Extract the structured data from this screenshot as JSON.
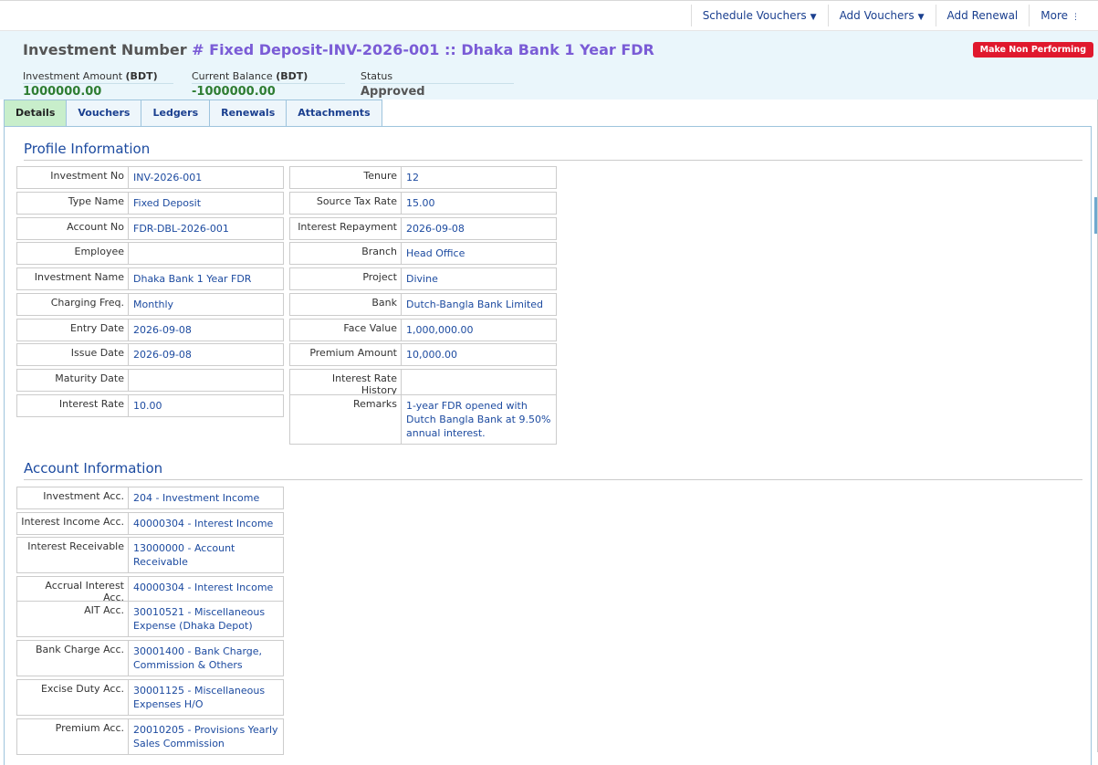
{
  "toolbar": {
    "schedule_vouchers": "Schedule Vouchers",
    "add_vouchers": "Add Vouchers",
    "add_renewal": "Add Renewal",
    "more": "More"
  },
  "header": {
    "title_prefix": "Investment Number",
    "title_highlight": "# Fixed Deposit-INV-2026-001 :: Dhaka Bank 1 Year FDR",
    "action_button": "Make Non Performing",
    "summary": {
      "investment_amount": {
        "label": "Investment Amount",
        "unit": "(BDT)",
        "value": "1000000.00"
      },
      "current_balance": {
        "label": "Current Balance",
        "unit": "(BDT)",
        "value": "-1000000.00"
      },
      "status": {
        "label": "Status",
        "value": "Approved"
      }
    }
  },
  "tabs": [
    "Details",
    "Vouchers",
    "Ledgers",
    "Renewals",
    "Attachments"
  ],
  "profile": {
    "title": "Profile Information",
    "left": [
      {
        "label": "Investment No",
        "value": "INV-2026-001"
      },
      {
        "label": "Type Name",
        "value": "Fixed Deposit"
      },
      {
        "label": "Account No",
        "value": "FDR-DBL-2026-001"
      },
      {
        "label": "Employee",
        "value": ""
      },
      {
        "label": "Investment Name",
        "value": "Dhaka Bank 1 Year FDR"
      },
      {
        "label": "Charging Freq.",
        "value": "Monthly"
      },
      {
        "label": "Entry Date",
        "value": "2026-09-08"
      },
      {
        "label": "Issue Date",
        "value": "2026-09-08"
      },
      {
        "label": "Maturity Date",
        "value": ""
      },
      {
        "label": "Interest Rate",
        "value": "10.00"
      }
    ],
    "right": [
      {
        "label": "Tenure",
        "value": "12"
      },
      {
        "label": "Source Tax Rate",
        "value": "15.00"
      },
      {
        "label": "Interest Repayment",
        "value": "2026-09-08"
      },
      {
        "label": "Branch",
        "value": "Head Office"
      },
      {
        "label": "Project",
        "value": "Divine"
      },
      {
        "label": "Bank",
        "value": "Dutch-Bangla Bank Limited"
      },
      {
        "label": "Face Value",
        "value": "1,000,000.00"
      },
      {
        "label": "Premium Amount",
        "value": "10,000.00"
      },
      {
        "label": "Interest Rate History",
        "value": ""
      },
      {
        "label": "Remarks",
        "value": "1-year FDR opened with Dutch Bangla Bank at 9.50% annual interest."
      }
    ]
  },
  "account": {
    "title": "Account Information",
    "rows": [
      {
        "label": "Investment Acc.",
        "value": "204 - Investment Income"
      },
      {
        "label": "Interest Income Acc.",
        "value": "40000304 - Interest Income"
      },
      {
        "label": "Interest Receivable",
        "value": "13000000 - Account Receivable"
      },
      {
        "label": "Accrual Interest Acc.",
        "value": "40000304 - Interest Income"
      },
      {
        "label": "AIT Acc.",
        "value": "30010521 - Miscellaneous Expense (Dhaka Depot)"
      },
      {
        "label": "Bank Charge Acc.",
        "value": "30001400 - Bank Charge, Commission & Others"
      },
      {
        "label": "Excise Duty Acc.",
        "value": "30001125 - Miscellaneous Expenses H/O"
      },
      {
        "label": "Premium Acc.",
        "value": "20010205 - Provisions Yearly Sales Commission"
      }
    ]
  }
}
